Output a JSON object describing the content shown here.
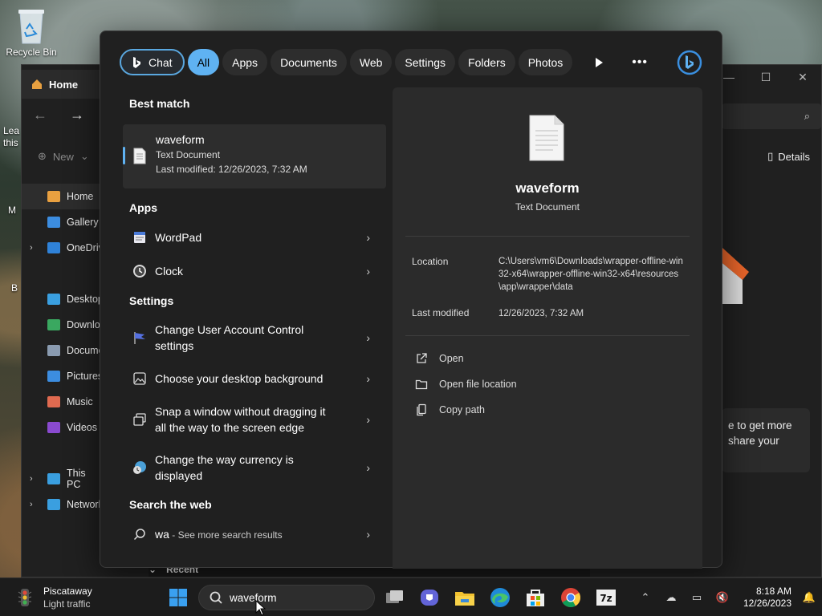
{
  "desktop": {
    "recycle_bin_label": "Recycle Bin",
    "side_text_1": "Lea",
    "side_text_2": "this",
    "side_text_3": "M",
    "side_text_4": "B"
  },
  "explorer": {
    "tab_label": "Home",
    "new_label": "New",
    "details_label": "Details",
    "sidebar": [
      {
        "label": "Home",
        "color": "#e8a040",
        "selected": true
      },
      {
        "label": "Gallery",
        "color": "#3c8de0"
      },
      {
        "label": "OneDrive",
        "color": "#2f82d8",
        "chevron": true
      },
      {
        "label": "Desktop",
        "color": "#3a9fe0"
      },
      {
        "label": "Downloa",
        "color": "#3aa860"
      },
      {
        "label": "Docume",
        "color": "#8a9bb0"
      },
      {
        "label": "Pictures",
        "color": "#3c8de0"
      },
      {
        "label": "Music",
        "color": "#e06a50"
      },
      {
        "label": "Videos",
        "color": "#8a4ad0"
      },
      {
        "label": "This PC",
        "color": "#3a9fe0",
        "chevron": true
      },
      {
        "label": "Network",
        "color": "#3a9fe0",
        "chevron": true
      }
    ],
    "card_text_1": "e to get more",
    "card_text_2": "share your",
    "recent_label": "Recent"
  },
  "search_panel": {
    "filters": [
      "Chat",
      "All",
      "Apps",
      "Documents",
      "Web",
      "Settings",
      "Folders",
      "Photos"
    ],
    "active_filter": "All",
    "best_match_heading": "Best match",
    "best_match": {
      "title": "waveform",
      "type": "Text Document",
      "modified": "Last modified: 12/26/2023, 7:32 AM"
    },
    "apps_heading": "Apps",
    "apps": [
      {
        "label": "WordPad",
        "icon": "wordpad-icon"
      },
      {
        "label": "Clock",
        "icon": "clock-icon"
      }
    ],
    "settings_heading": "Settings",
    "settings": [
      {
        "line1": "Change User Account Control",
        "line2": "settings",
        "icon": "uac-flag-icon"
      },
      {
        "line1": "Choose your desktop background",
        "line2": "",
        "icon": "image-icon"
      },
      {
        "line1": "Snap a window without dragging it",
        "line2": "all the way to the screen edge",
        "icon": "snap-window-icon"
      },
      {
        "line1": "Change the way currency is",
        "line2": "displayed",
        "icon": "region-globe-icon"
      }
    ],
    "web_heading": "Search the web",
    "web_query": "wa",
    "web_suffix": " - See more search results"
  },
  "preview": {
    "title": "waveform",
    "type": "Text Document",
    "location_label": "Location",
    "location_value": "C:\\Users\\vm6\\Downloads\\wrapper-offline-win32-x64\\wrapper-offline-win32-x64\\resources\\app\\wrapper\\data",
    "modified_label": "Last modified",
    "modified_value": "12/26/2023, 7:32 AM",
    "actions": [
      "Open",
      "Open file location",
      "Copy path"
    ]
  },
  "taskbar": {
    "weather_city": "Piscataway",
    "weather_status": "Light traffic",
    "search_value": "waveform",
    "time": "8:18 AM",
    "date": "12/26/2023"
  },
  "colors": {
    "accent": "#5fb2f2",
    "panel_bg": "#202020",
    "preview_bg": "#2b2b2b"
  }
}
